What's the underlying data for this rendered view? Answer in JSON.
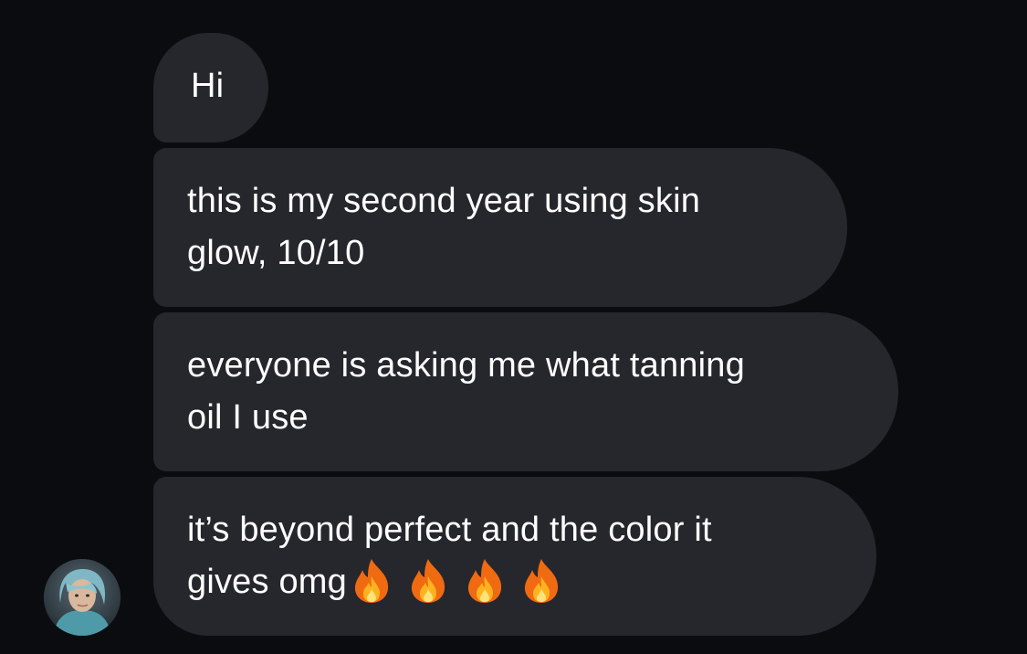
{
  "messages": [
    {
      "lines": [
        "Hi"
      ]
    },
    {
      "lines": [
        "this is my second year using skin",
        "glow, 10/10"
      ]
    },
    {
      "lines": [
        "everyone is asking me what tanning",
        "oil I use"
      ]
    },
    {
      "lines": [
        "it’s beyond perfect and the color it",
        "gives omg"
      ],
      "emoji": [
        "fire-icon",
        "fire-icon",
        "fire-icon",
        "fire-icon"
      ]
    }
  ],
  "colors": {
    "background": "#0b0c10",
    "bubble": "#25272c",
    "text": "#ffffff"
  },
  "sender": {
    "avatar_icon": "profile-photo"
  }
}
